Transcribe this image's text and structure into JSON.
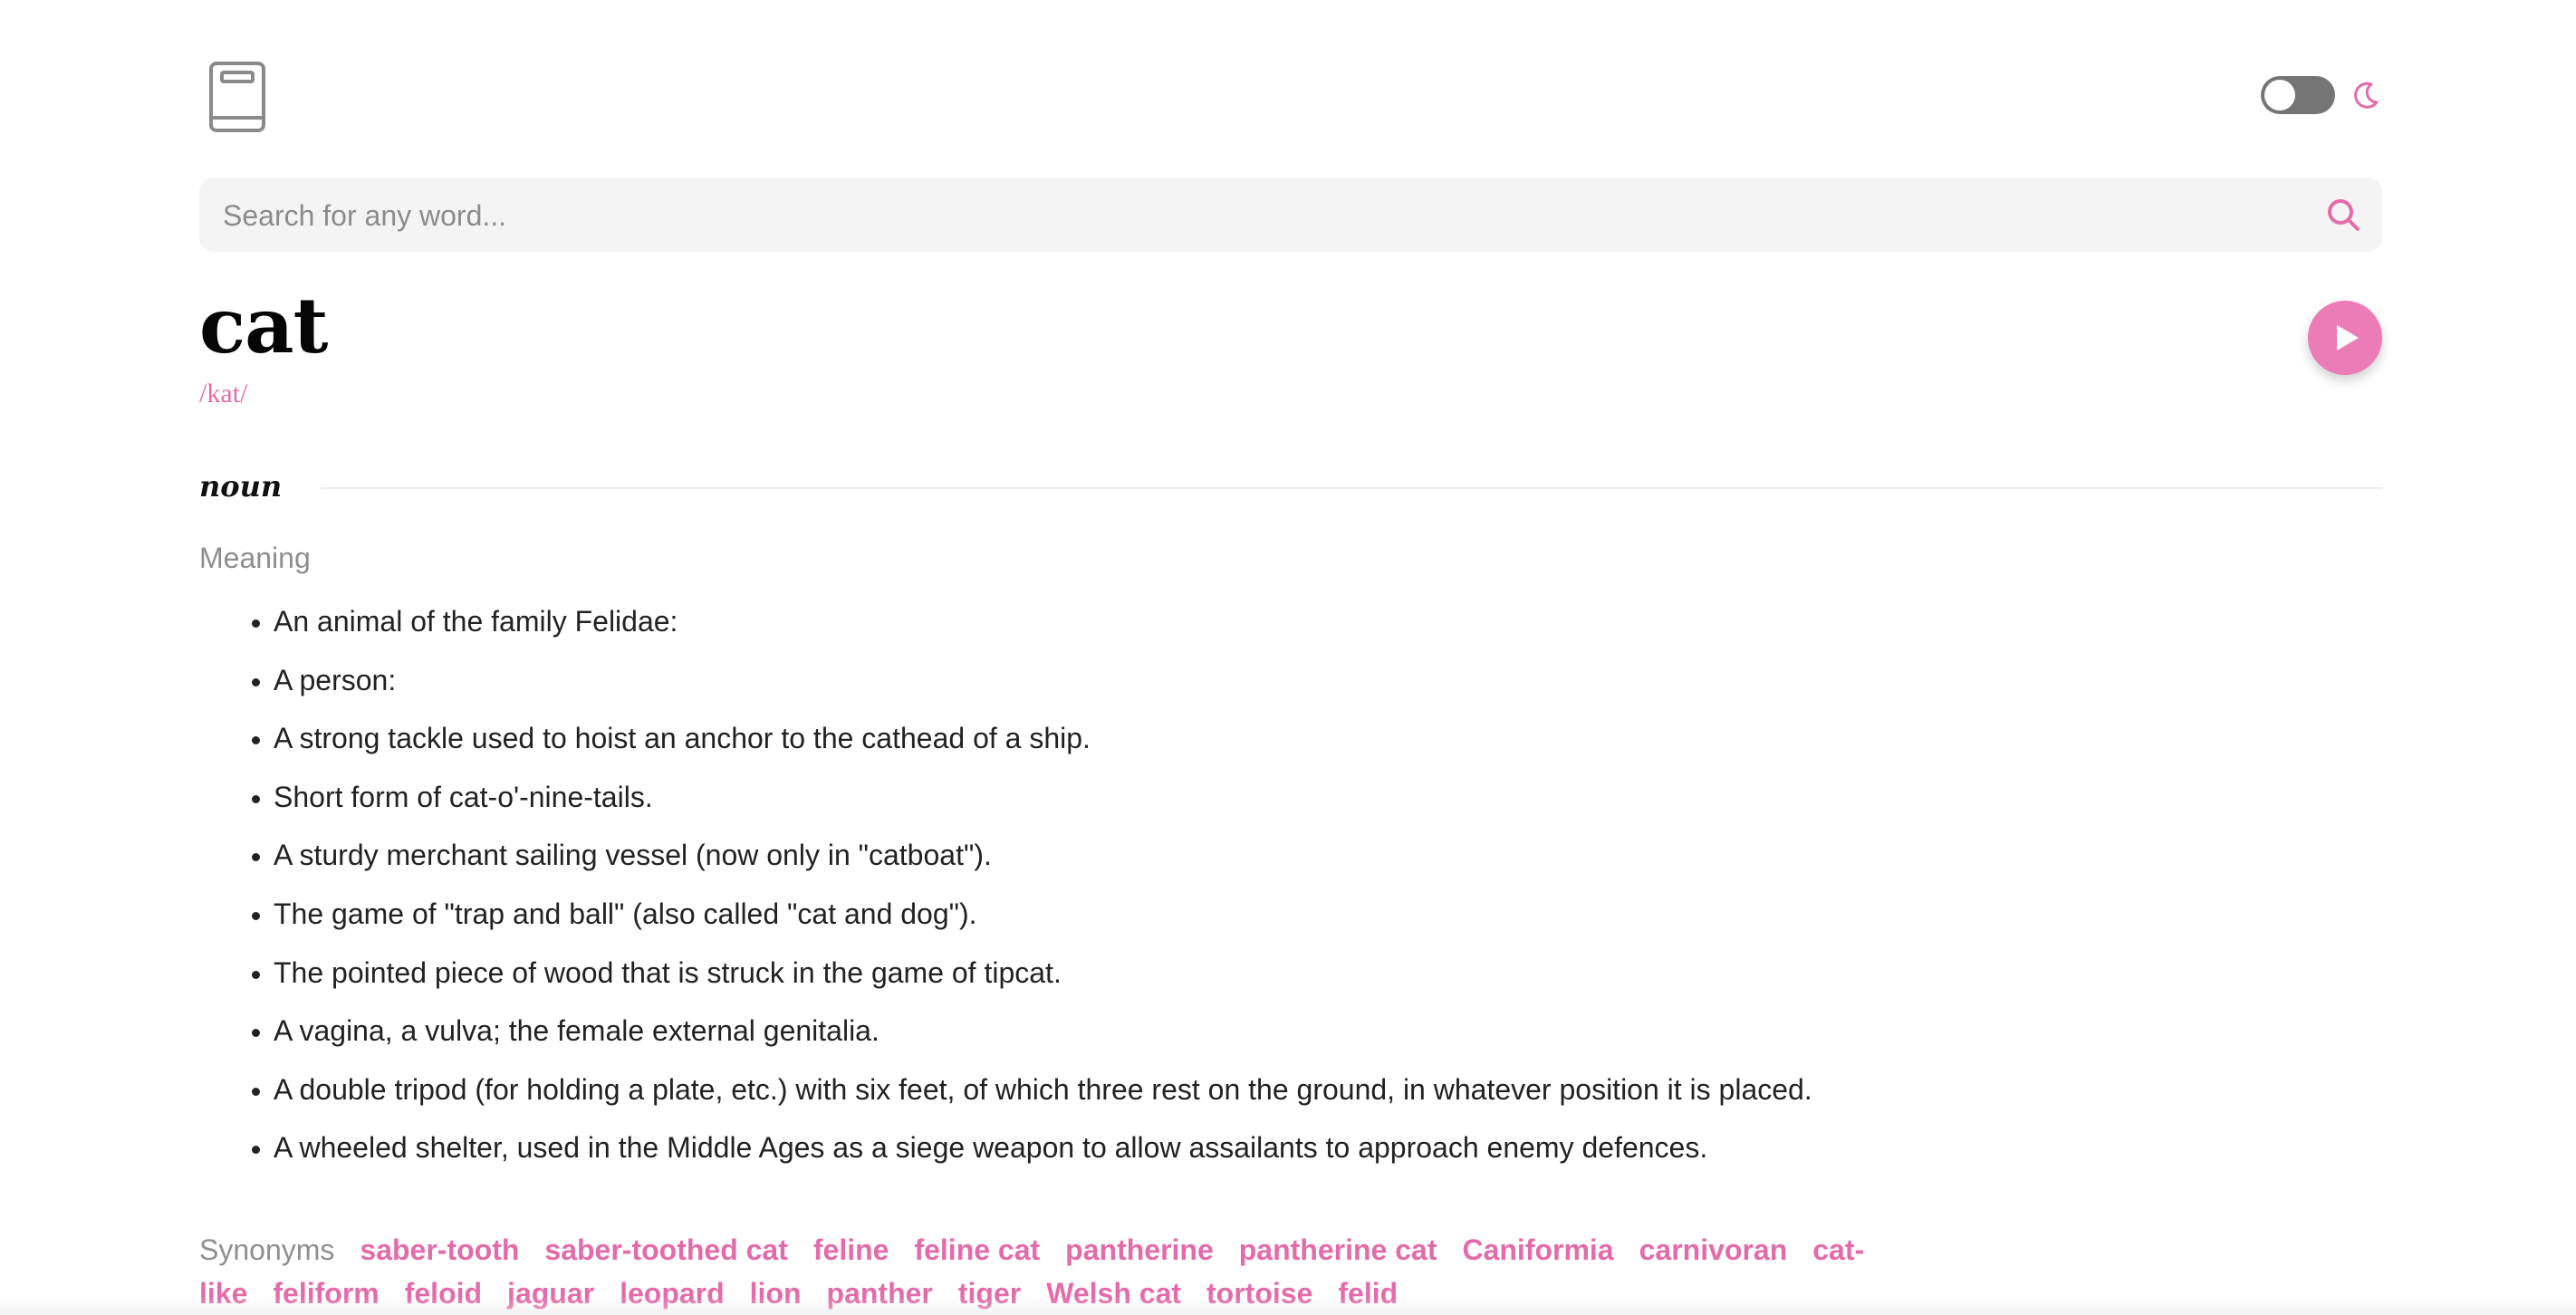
{
  "header": {
    "logo_icon": "book-icon",
    "theme_toggle_state": "off",
    "theme_icon": "moon-icon"
  },
  "search": {
    "placeholder": "Search for any word...",
    "value": "",
    "icon": "search-icon"
  },
  "entry": {
    "word": "cat",
    "phonetic": "/kat/",
    "play_icon": "play-icon",
    "part_of_speech": "noun",
    "meaning_heading": "Meaning",
    "definitions": [
      "An animal of the family Felidae:",
      "A person:",
      "A strong tackle used to hoist an anchor to the cathead of a ship.",
      "Short form of cat-o'-nine-tails.",
      "A sturdy merchant sailing vessel (now only in \"catboat\").",
      "The game of \"trap and ball\" (also called \"cat and dog\").",
      "The pointed piece of wood that is struck in the game of tipcat.",
      "A vagina, a vulva; the female external genitalia.",
      "A double tripod (for holding a plate, etc.) with six feet, of which three rest on the ground, in whatever position it is placed.",
      "A wheeled shelter, used in the Middle Ages as a siege weapon to allow assailants to approach enemy defences."
    ],
    "synonyms_label": "Synonyms",
    "synonyms": [
      "saber-tooth",
      "saber-toothed cat",
      "feline",
      "feline cat",
      "pantherine",
      "pantherine cat",
      "Caniformia",
      "carnivoran",
      "cat-like",
      "feliform",
      "feloid",
      "jaguar",
      "leopard",
      "lion",
      "panther",
      "tiger",
      "Welsh cat",
      "tortoise",
      "felid"
    ]
  },
  "colors": {
    "accent": "#e46ba9",
    "play_button": "#ec7cb6",
    "muted_text": "#8e8e8e",
    "search_bg": "#f4f4f4"
  }
}
